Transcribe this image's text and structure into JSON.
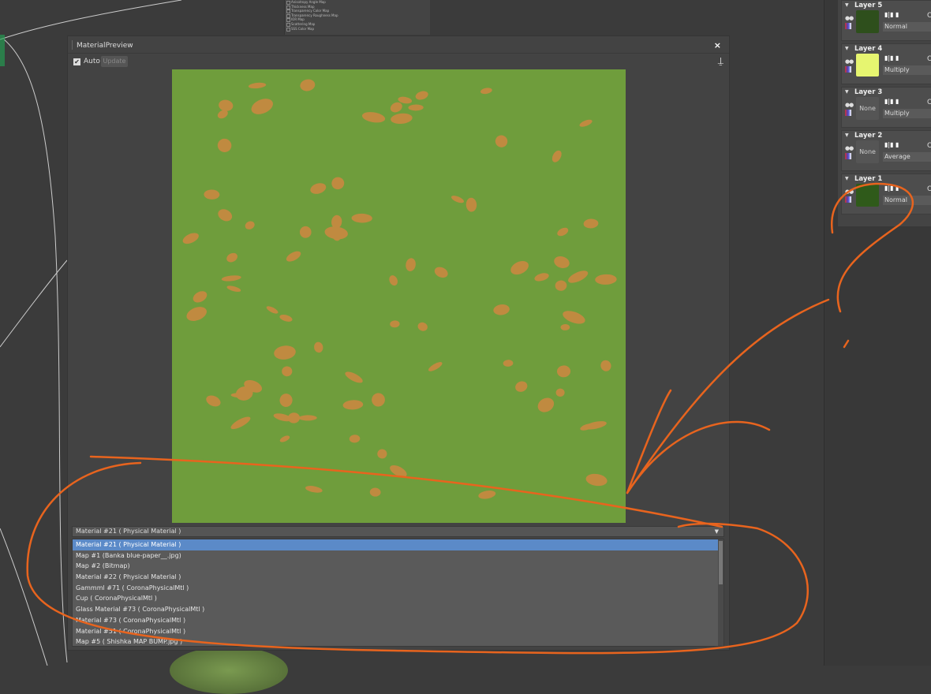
{
  "top_list": [
    "Anisotropy Angle Map",
    "Thickness Map",
    "Transparency Color Map",
    "Transparency Roughness Map",
    "IOR Map",
    "Scattering Map",
    "SSS Color Map"
  ],
  "dialog": {
    "title": "MaterialPreview",
    "close": "×",
    "auto_label": "Auto",
    "auto_checked": true,
    "update_label": "Update",
    "picker_icon": "eyedropper-icon"
  },
  "selector": {
    "value": "Material #21  ( Physical Material )",
    "options": [
      "Material #21  ( Physical Material )",
      "Map #1 (Banka blue-paper__.jpg)",
      "Map #2 (Bitmap)",
      "Material #22  ( Physical Material )",
      "Gammml #71  ( CoronaPhysicalMtl )",
      "Cup  ( CoronaPhysicalMtl )",
      "Glass  Material #73  ( CoronaPhysicalMtl )",
      "Material #73  ( CoronaPhysicalMtl )",
      "Material #51  ( CoronaPhysicalMtl )",
      "Map #5 ( Shishka MAP BUMP.jpg )"
    ],
    "selected_index": 0
  },
  "layers": [
    {
      "name": "Layer 5",
      "thumb": "",
      "blend": "Normal",
      "color": "#2e4f1c"
    },
    {
      "name": "Layer 4",
      "thumb": "",
      "blend": "Multiply",
      "color": "#e6f570"
    },
    {
      "name": "Layer 3",
      "thumb": "None",
      "blend": "Multiply",
      "color": ""
    },
    {
      "name": "Layer 2",
      "thumb": "None",
      "blend": "Average",
      "color": ""
    },
    {
      "name": "Layer 1",
      "thumb": "",
      "blend": "Normal",
      "color": "#2f5a1a"
    }
  ],
  "colors": {
    "accent": "#5b8ac8",
    "texture_green": "#6f9d3c",
    "spot": "#c08a40",
    "annotation": "#e8641e"
  }
}
